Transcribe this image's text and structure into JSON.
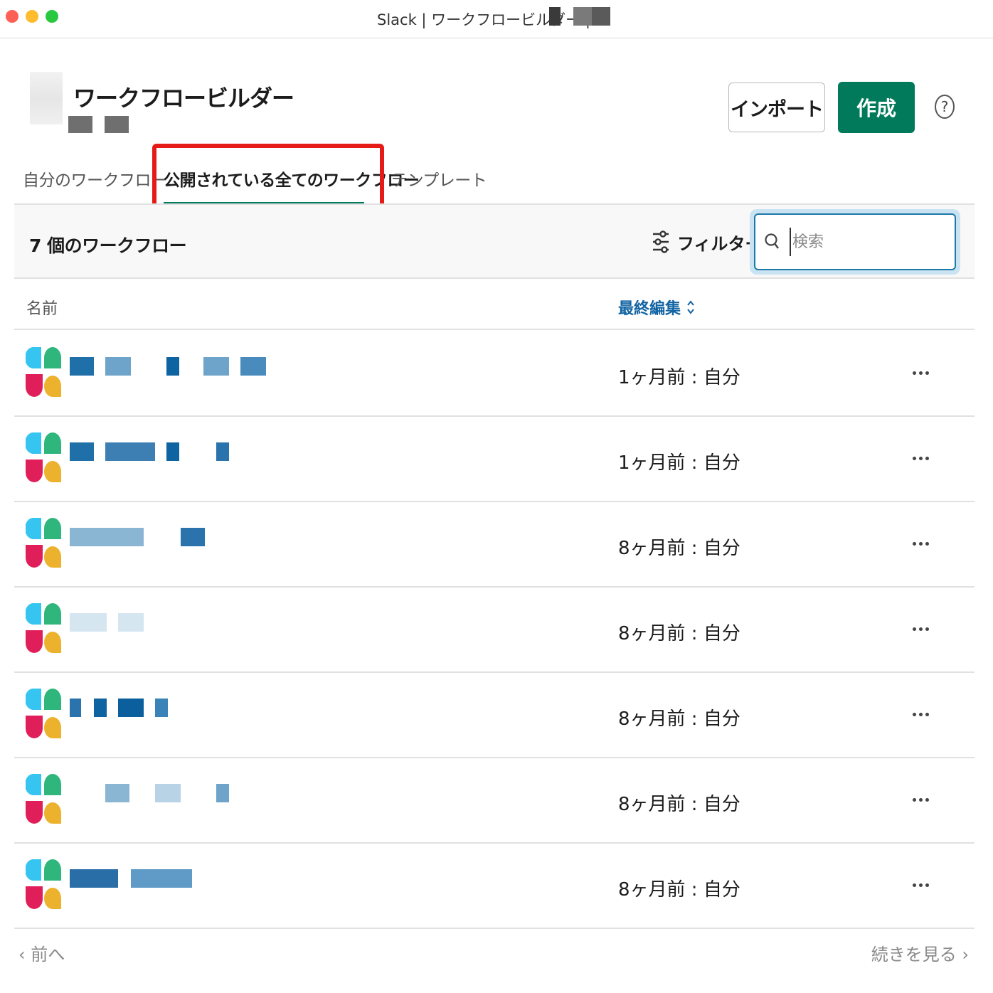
{
  "window": {
    "title": "Slack | ワークフロービルダー |"
  },
  "header": {
    "page_title": "ワークフロービルダー",
    "import_label": "インポート",
    "create_label": "作成",
    "help_glyph": "?"
  },
  "tabs": [
    {
      "label": "自分のワークフロー",
      "active": false
    },
    {
      "label": "公開されている全てのワークフロー",
      "active": true
    },
    {
      "label": "テンプレート",
      "active": false
    }
  ],
  "toolbar": {
    "count_label": "7 個のワークフロー",
    "filter_label": "フィルター",
    "search_placeholder": "検索"
  },
  "table": {
    "col_name": "名前",
    "col_last_edited": "最終編集",
    "sort_glyph": "⌃⌄",
    "rows": [
      {
        "time": "1ヶ月前 : 自分"
      },
      {
        "time": "1ヶ月前 : 自分"
      },
      {
        "time": "8ヶ月前 : 自分"
      },
      {
        "time": "8ヶ月前 : 自分"
      },
      {
        "time": "8ヶ月前 : 自分"
      },
      {
        "time": "8ヶ月前 : 自分"
      },
      {
        "time": "8ヶ月前 : 自分"
      }
    ]
  },
  "pager": {
    "prev_label": "‹ 前へ",
    "next_label": "続きを見る ›"
  },
  "colors": {
    "accent_green": "#007a5a",
    "link_blue": "#1264a3",
    "highlight_red": "#e41b17"
  },
  "icons": [
    "help-icon",
    "filter-icon",
    "search-icon",
    "more-icon",
    "sort-icon",
    "workflow-icon"
  ]
}
